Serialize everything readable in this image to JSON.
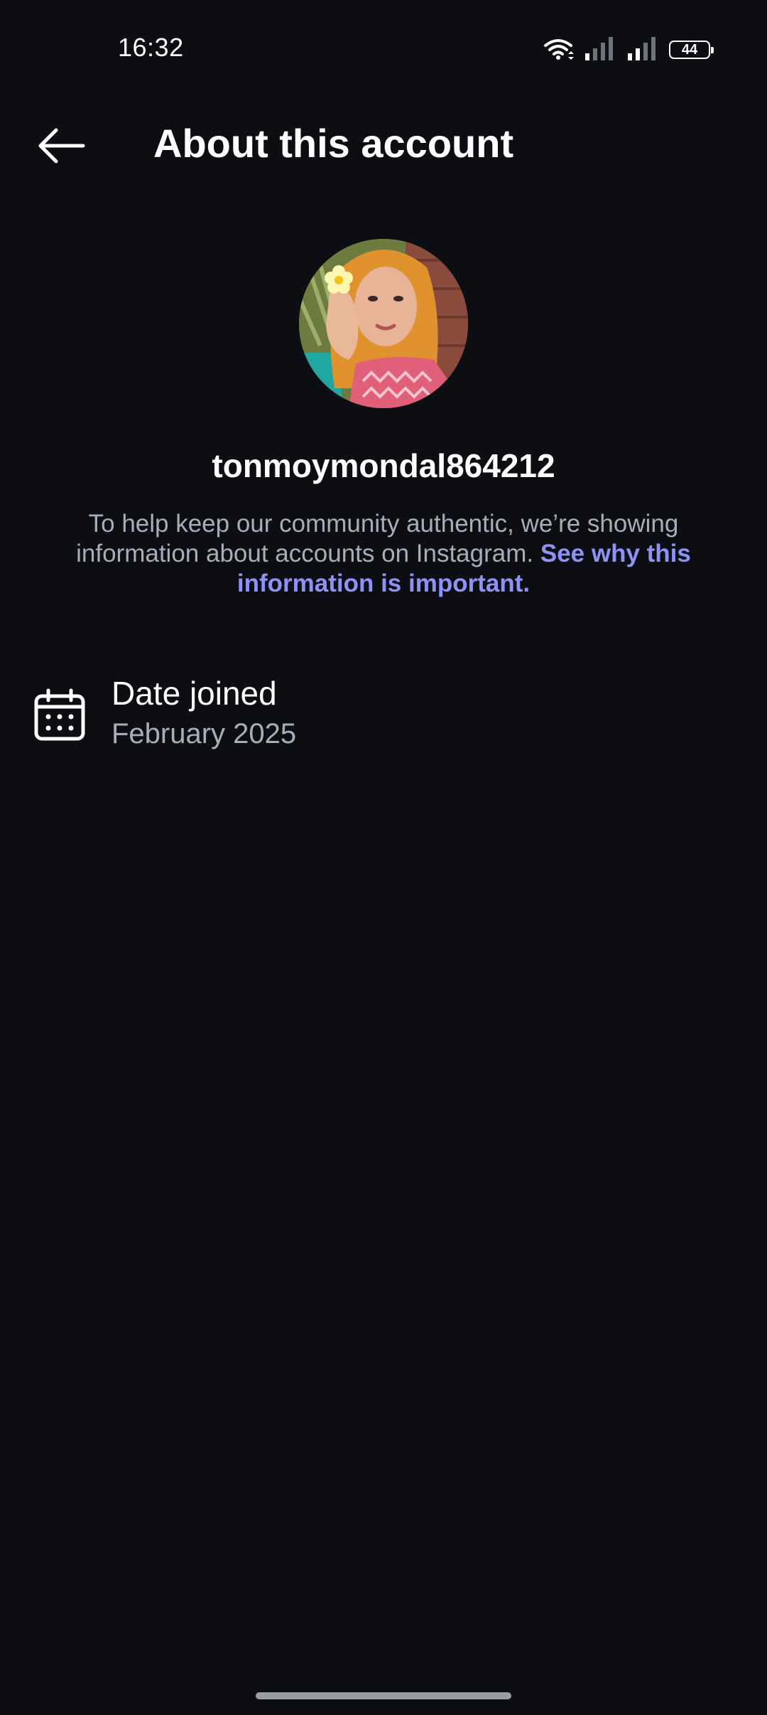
{
  "status_bar": {
    "time": "16:32",
    "battery_level": "44",
    "icons": [
      "wifi-icon",
      "signal-sim1-icon",
      "signal-sim2-icon",
      "battery-icon"
    ]
  },
  "header": {
    "title": "About this account",
    "back_icon": "arrow-left-icon"
  },
  "profile": {
    "username": "tonmoymondal864212",
    "avatar": "profile-photo"
  },
  "description": {
    "text": "To help keep our community authentic, we’re showing information about accounts on Instagram. ",
    "link_text": "See why this information is important."
  },
  "info_items": [
    {
      "icon": "calendar-icon",
      "label": "Date joined",
      "value": "February 2025"
    }
  ],
  "colors": {
    "background": "#0c0e13",
    "primary_text": "#ffffff",
    "secondary_text": "#a8adb6",
    "link": "#8e92f5"
  }
}
